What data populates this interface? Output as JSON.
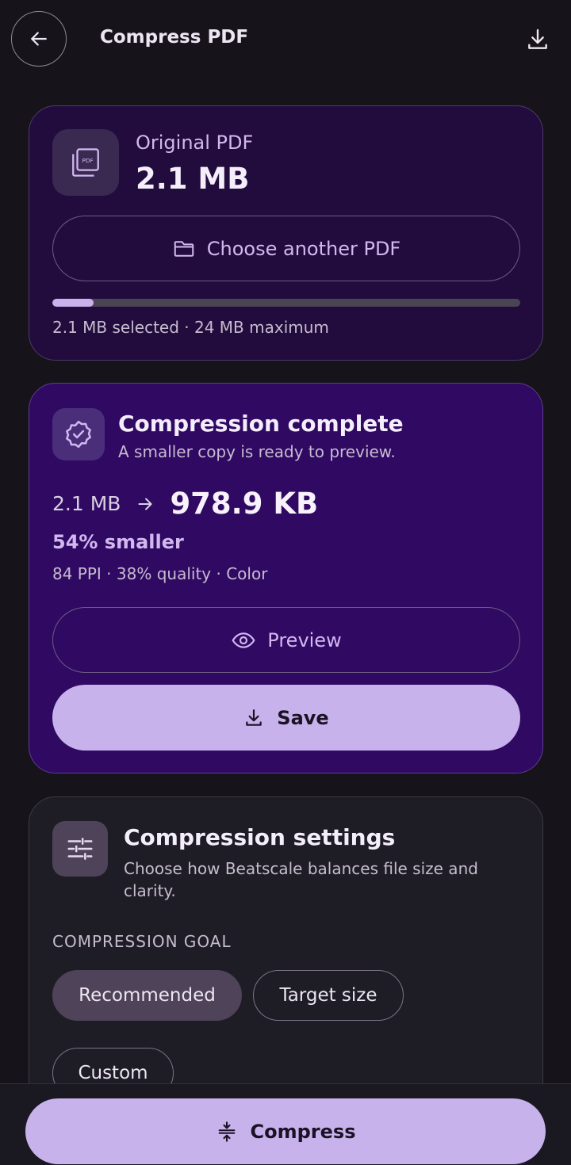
{
  "header": {
    "title": "Compress PDF",
    "back_icon": "arrow-left-icon",
    "download_icon": "download-icon"
  },
  "original": {
    "label": "Original PDF",
    "size": "2.1 MB",
    "choose_button": "Choose another PDF",
    "usage_fraction": 0.0875,
    "usage_text": "2.1 MB selected · 24 MB maximum"
  },
  "result": {
    "title": "Compression complete",
    "subtitle": "A smaller copy is ready to preview.",
    "size_from": "2.1 MB",
    "size_to": "978.9 KB",
    "percent": "54% smaller",
    "details": "84 PPI · 38% quality · Color",
    "preview_button": "Preview",
    "save_button": "Save"
  },
  "settings": {
    "title": "Compression settings",
    "subtitle": "Choose how Beatscale balances file size and clarity.",
    "goal_label": "COMPRESSION GOAL",
    "goals": [
      "Recommended",
      "Target size",
      "Custom"
    ],
    "selected_goal": "Recommended"
  },
  "footer": {
    "compress_button": "Compress"
  },
  "colors": {
    "background": "#16141a",
    "accent": "#c7b2ec",
    "result_card": "#300963",
    "original_card": "#220c3d"
  }
}
